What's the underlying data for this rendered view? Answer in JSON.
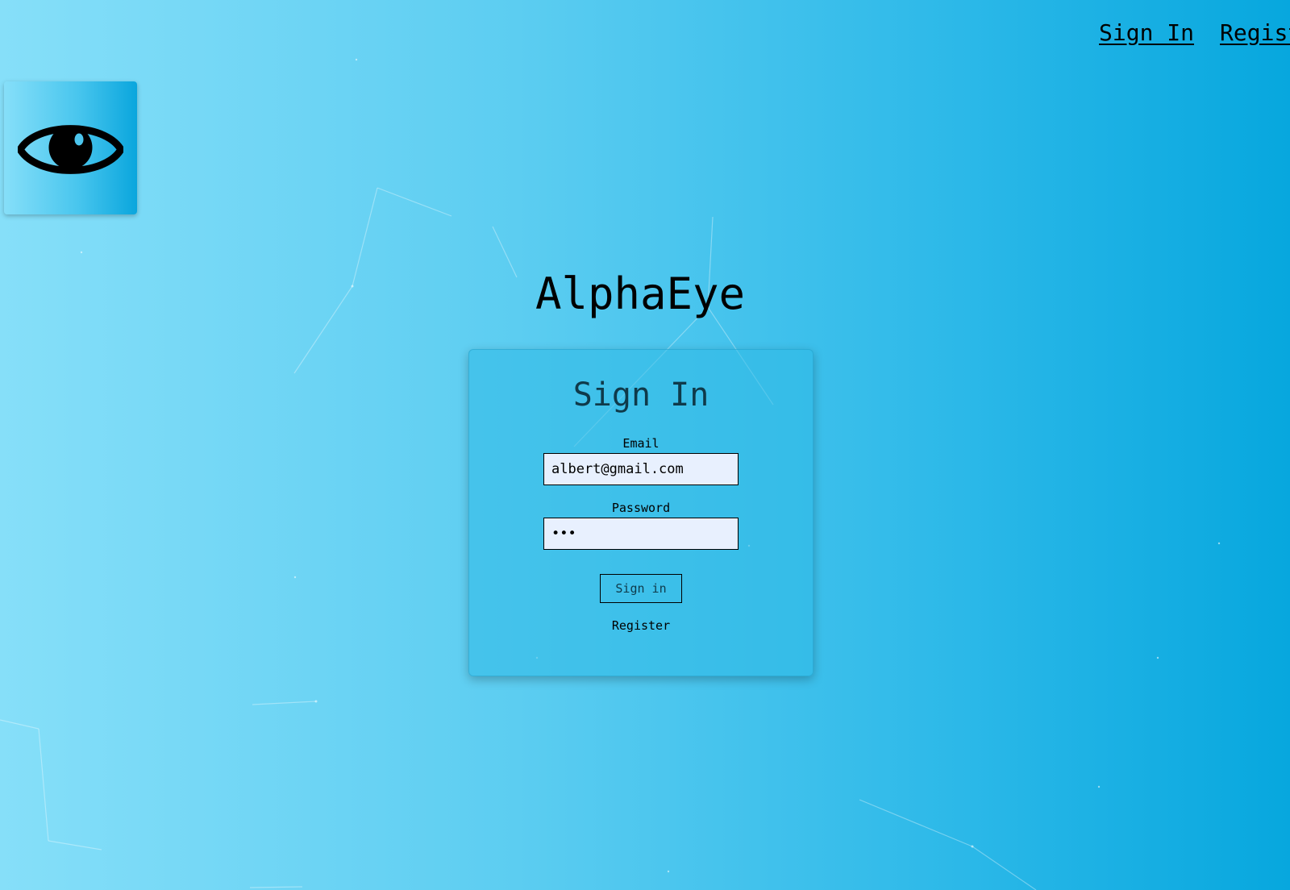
{
  "nav": {
    "signin_label": "Sign In",
    "register_label": "Register"
  },
  "logo": {
    "icon": "eye-icon",
    "tile_colors": [
      "#86dff9",
      "#0aa6dd"
    ]
  },
  "app_title": "AlphaEye",
  "signin_form": {
    "title": "Sign In",
    "email_label": "Email",
    "email_value": "albert@gmail.com",
    "password_label": "Password",
    "password_value": "abc",
    "submit_label": "Sign in",
    "register_link": "Register"
  },
  "colors": {
    "background_start": "#86dff9",
    "background_end": "#07a7de",
    "input_background": "#e8f0fe"
  }
}
